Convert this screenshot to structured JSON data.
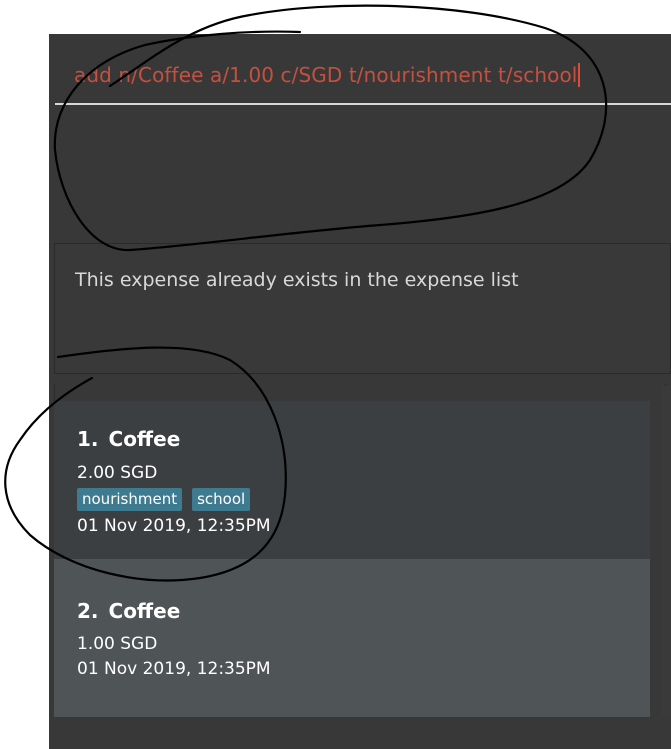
{
  "command": {
    "input_value": "add n/Coffee a/1.00 c/SGD t/nourishment t/school"
  },
  "result": {
    "message": "This expense already exists in the expense list"
  },
  "expenses": [
    {
      "index": "1.",
      "name": "Coffee",
      "amount": "2.00 SGD",
      "tags": [
        "nourishment",
        "school"
      ],
      "date": "01 Nov 2019, 12:35PM"
    },
    {
      "index": "2.",
      "name": "Coffee",
      "amount": "1.00 SGD",
      "tags": [],
      "date": "01 Nov 2019, 12:35PM"
    }
  ],
  "colors": {
    "app_background": "#383838",
    "command_text": "#c6503f",
    "tag_background": "#3e7b91",
    "card_selected_background": "#4f5456",
    "card_background": "#3c3f41",
    "annotation_ink": "#000000"
  }
}
